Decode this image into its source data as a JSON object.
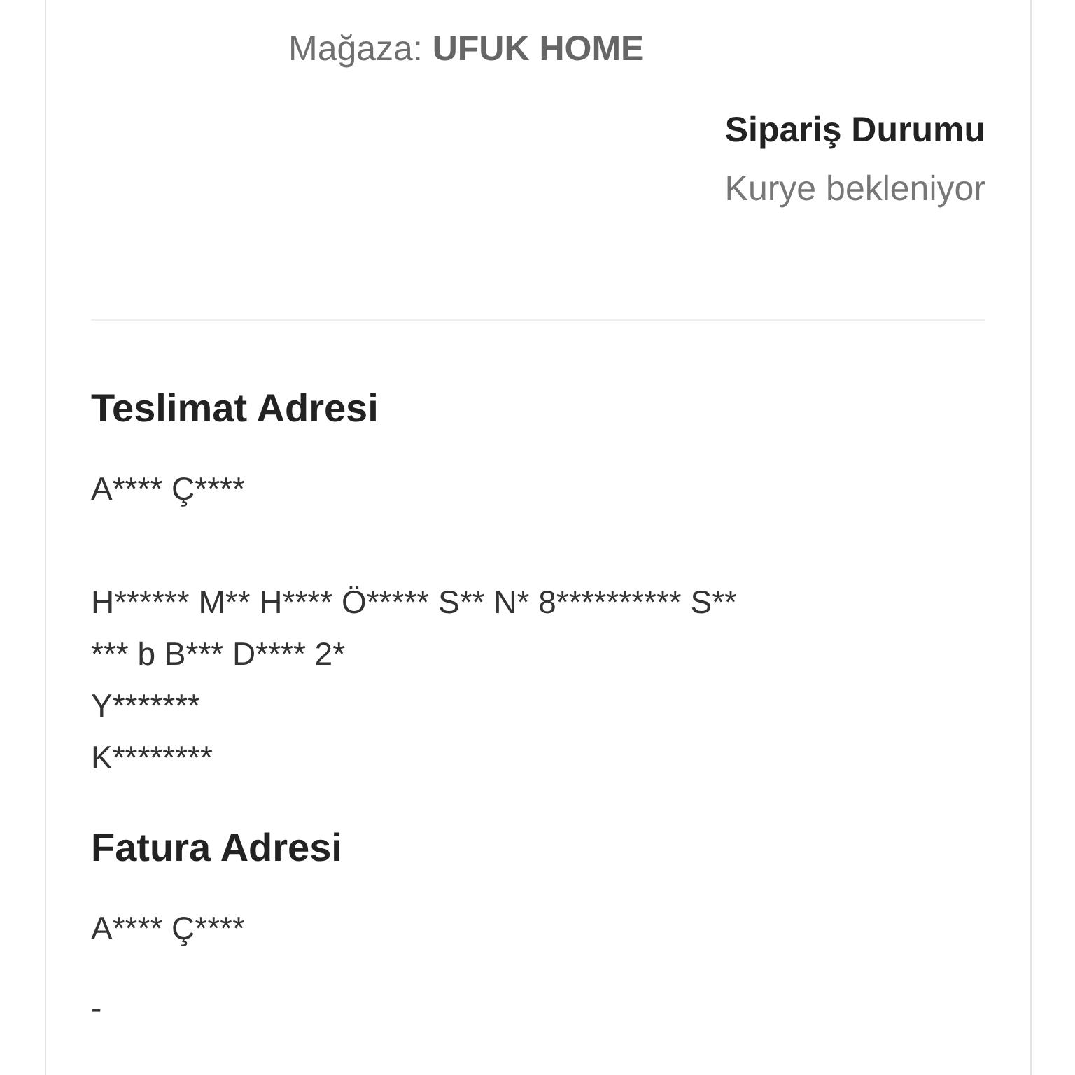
{
  "store": {
    "label": "Mağaza:",
    "name": "UFUK HOME"
  },
  "order_status": {
    "title": "Sipariş Durumu",
    "value": "Kurye bekleniyor"
  },
  "sections": [
    {
      "title": "Teslimat Adresi",
      "recipient": "A**** Ç****",
      "lines": [
        "H****** M** H**** Ö***** S** N* 8********** S**",
        "*** b B*** D**** 2*",
        "Y*******",
        "K********"
      ]
    },
    {
      "title": "Fatura Adresi",
      "recipient": "A**** Ç****",
      "lines": [
        "-"
      ]
    }
  ]
}
